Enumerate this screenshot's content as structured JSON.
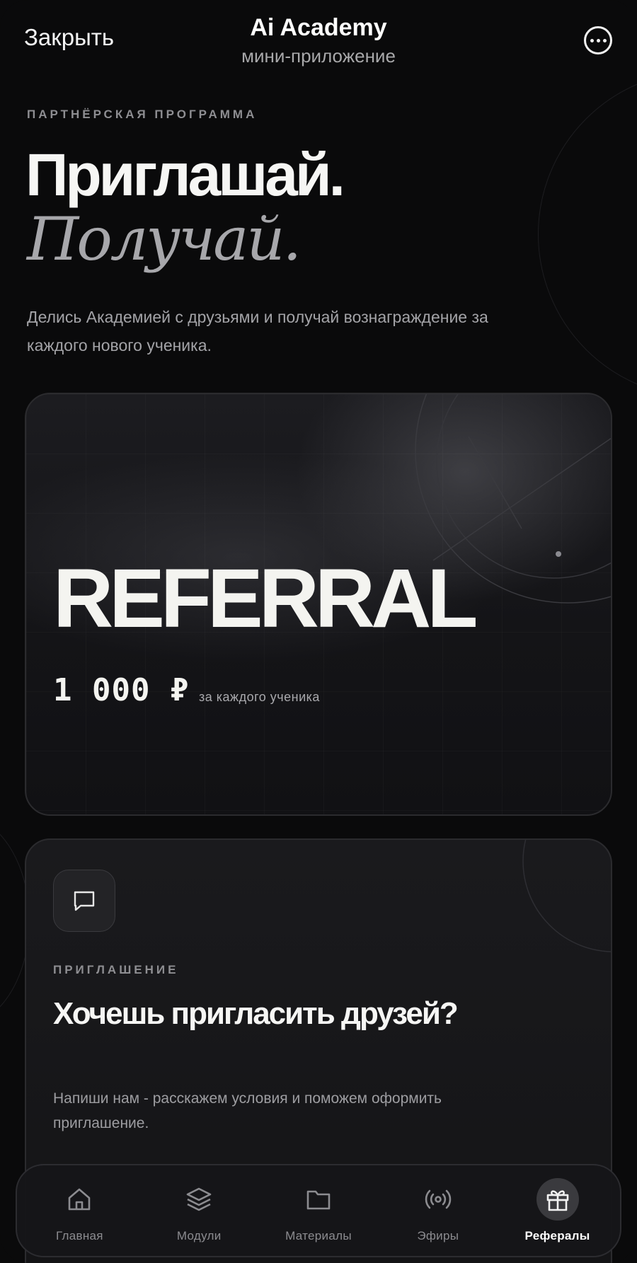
{
  "header": {
    "close_label": "Закрыть",
    "title": "Ai Academy",
    "subtitle": "мини-приложение",
    "more_icon": "more-dots-icon"
  },
  "hero": {
    "eyebrow": "ПАРТНЁРСКАЯ ПРОГРАММА",
    "headline": "Приглашай.",
    "headline_italic": "Получай.",
    "description": "Делись Академией с друзьями и получай вознаграждение за каждого нового ученика."
  },
  "referral_card": {
    "word": "REFERRAL",
    "amount": "1 000 ₽",
    "amount_note": "за каждого ученика"
  },
  "invite_card": {
    "icon": "chat-bubble-icon",
    "eyebrow": "ПРИГЛАШЕНИЕ",
    "title": "Хочешь пригласить друзей?",
    "description": "Напиши нам - расскажем условия и поможем оформить приглашение."
  },
  "tabbar": {
    "tabs": [
      {
        "label": "Главная",
        "icon": "home-icon"
      },
      {
        "label": "Модули",
        "icon": "layers-icon"
      },
      {
        "label": "Материалы",
        "icon": "folder-icon"
      },
      {
        "label": "Эфиры",
        "icon": "broadcast-icon"
      },
      {
        "label": "Рефералы",
        "icon": "gift-icon"
      }
    ],
    "active": "Рефералы"
  },
  "colors": {
    "background": "#0a0a0b",
    "card": "#161618",
    "text_primary": "#f4f4f0",
    "text_muted": "#a3a3a7"
  }
}
